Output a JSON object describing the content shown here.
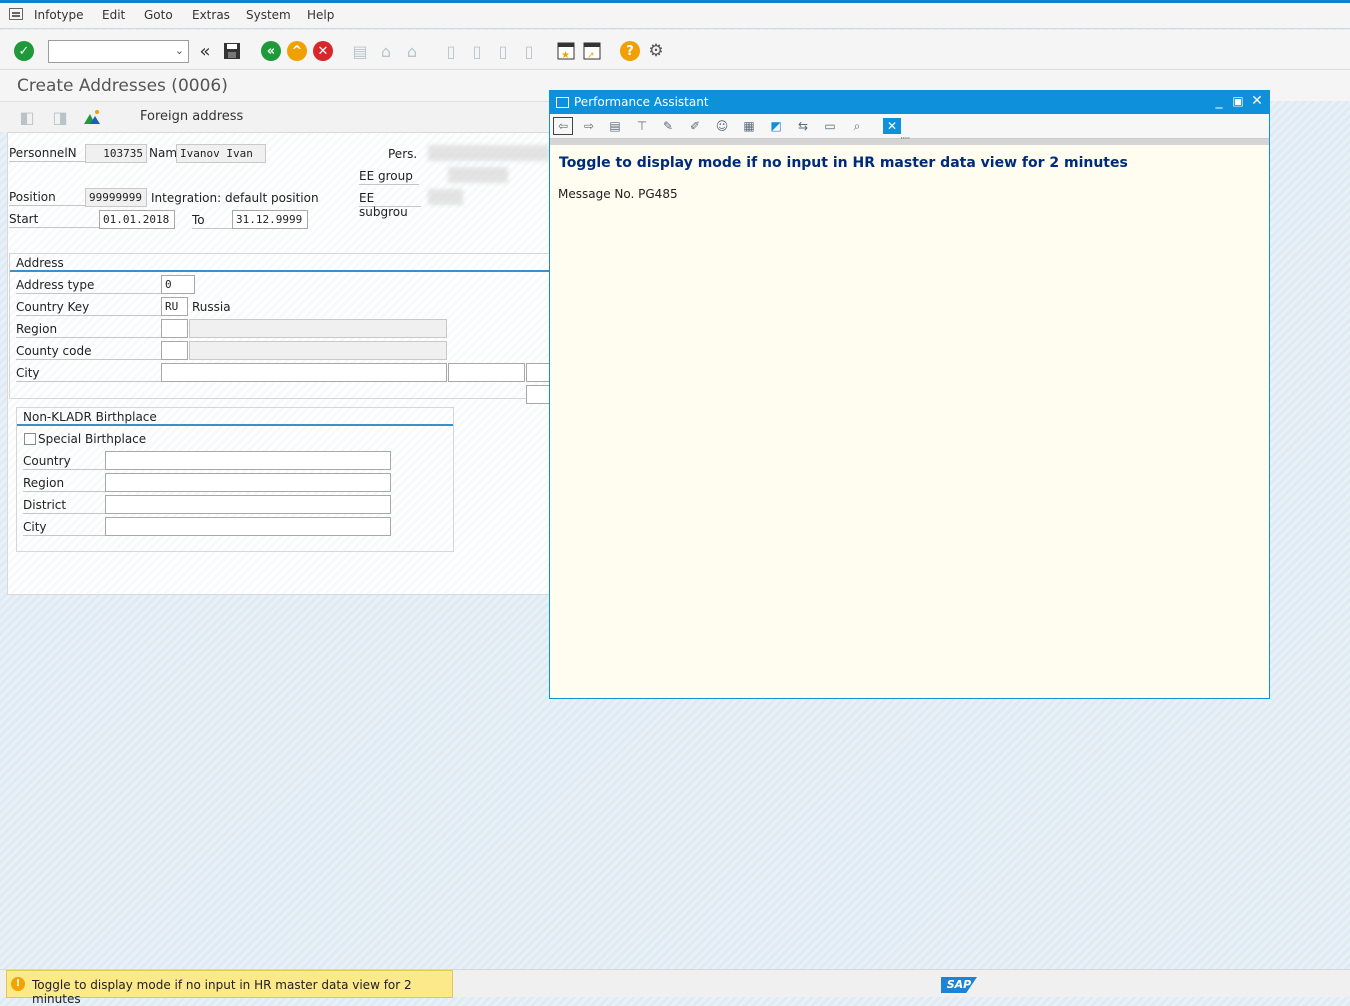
{
  "menu": {
    "items": [
      "Infotype",
      "Edit",
      "Goto",
      "Extras",
      "System",
      "Help"
    ]
  },
  "toolbar": {
    "command_field": ""
  },
  "title": "Create Addresses (0006)",
  "app_toolbar": {
    "foreign_address": "Foreign address"
  },
  "header": {
    "personnel_label": "PersonnelN",
    "personnel_value": "103735",
    "name_label": "Nam",
    "name_value": "Ivanov Ivan",
    "pers_label": "Pers.",
    "ee_group_label": "EE group",
    "ee_subgroup_label": "EE subgrou",
    "position_label": "Position",
    "position_value": "99999999",
    "position_text": "Integration: default position",
    "start_label": "Start",
    "start_value": "01.01.2018",
    "to_label": "To",
    "to_value": "31.12.9999"
  },
  "address": {
    "title": "Address",
    "address_type_label": "Address type",
    "address_type_value": "0",
    "country_key_label": "Country Key",
    "country_key_value": "RU",
    "country_name": "Russia",
    "region_label": "Region",
    "county_code_label": "County code",
    "city_label": "City"
  },
  "birthplace": {
    "title": "Non-KLADR Birthplace",
    "special_label": "Special Birthplace",
    "country_label": "Country",
    "region_label": "Region",
    "district_label": "District",
    "city_label": "City"
  },
  "popup": {
    "title": "Performance Assistant",
    "heading": "Toggle to display mode if no input in HR master data view for 2 minutes",
    "message_no": "Message No. PG485"
  },
  "status": {
    "message": "Toggle to display mode if no input in HR master data view for 2 minutes",
    "logo": "SAP"
  }
}
